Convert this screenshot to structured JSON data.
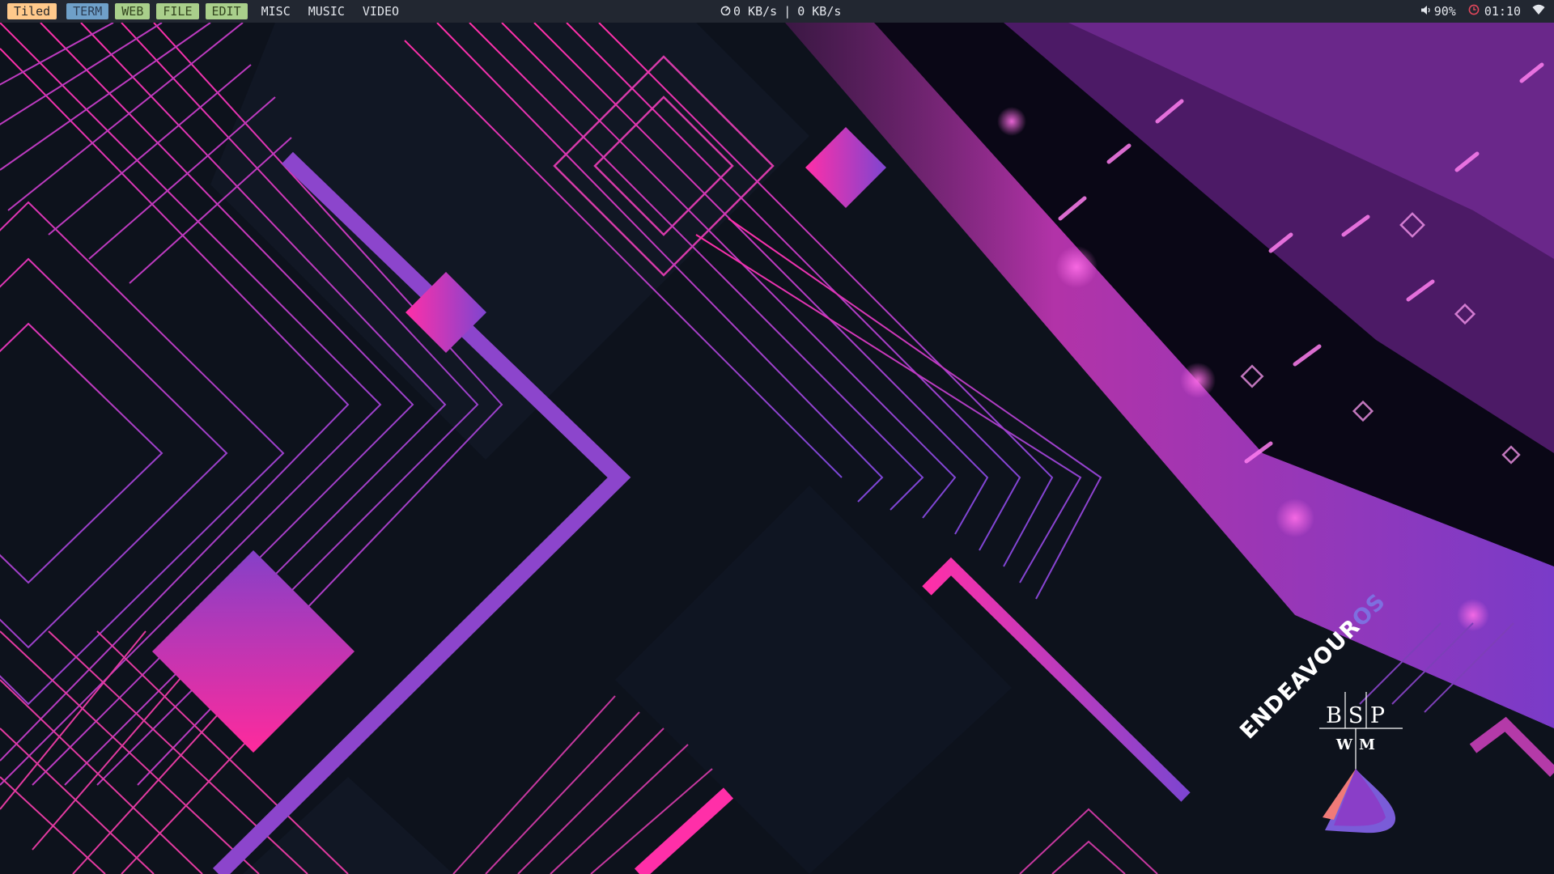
{
  "topbar": {
    "mode": "Tiled",
    "workspaces": [
      "TERM",
      "WEB",
      "FILE",
      "EDIT",
      "MISC",
      "MUSIC",
      "VIDEO"
    ],
    "net_icon": "speedometer-icon",
    "net_down": "0 KB/s",
    "net_sep": "|",
    "net_up": "0 KB/s",
    "volume_icon": "speaker-icon",
    "volume": "90%",
    "clock_icon": "clock-icon",
    "time": "01:10",
    "wifi_icon": "wifi-icon"
  },
  "desktop": {
    "logo_endeavour": "ENDEAVOUR",
    "logo_os": "OS",
    "logo_bsp_b": "B",
    "logo_bsp_s": "S",
    "logo_bsp_p": "P",
    "logo_wm_w": "W",
    "logo_wm_m": "M"
  },
  "colors": {
    "bar_bg": "#222731",
    "wallpaper_bg": "#0d121c",
    "pink": "#ff2fa8",
    "purple": "#8a45c8",
    "mode_bg": "#ffc98b",
    "term_bg": "#6fa0c9",
    "ws_active_bg": "#a9cf8b"
  }
}
